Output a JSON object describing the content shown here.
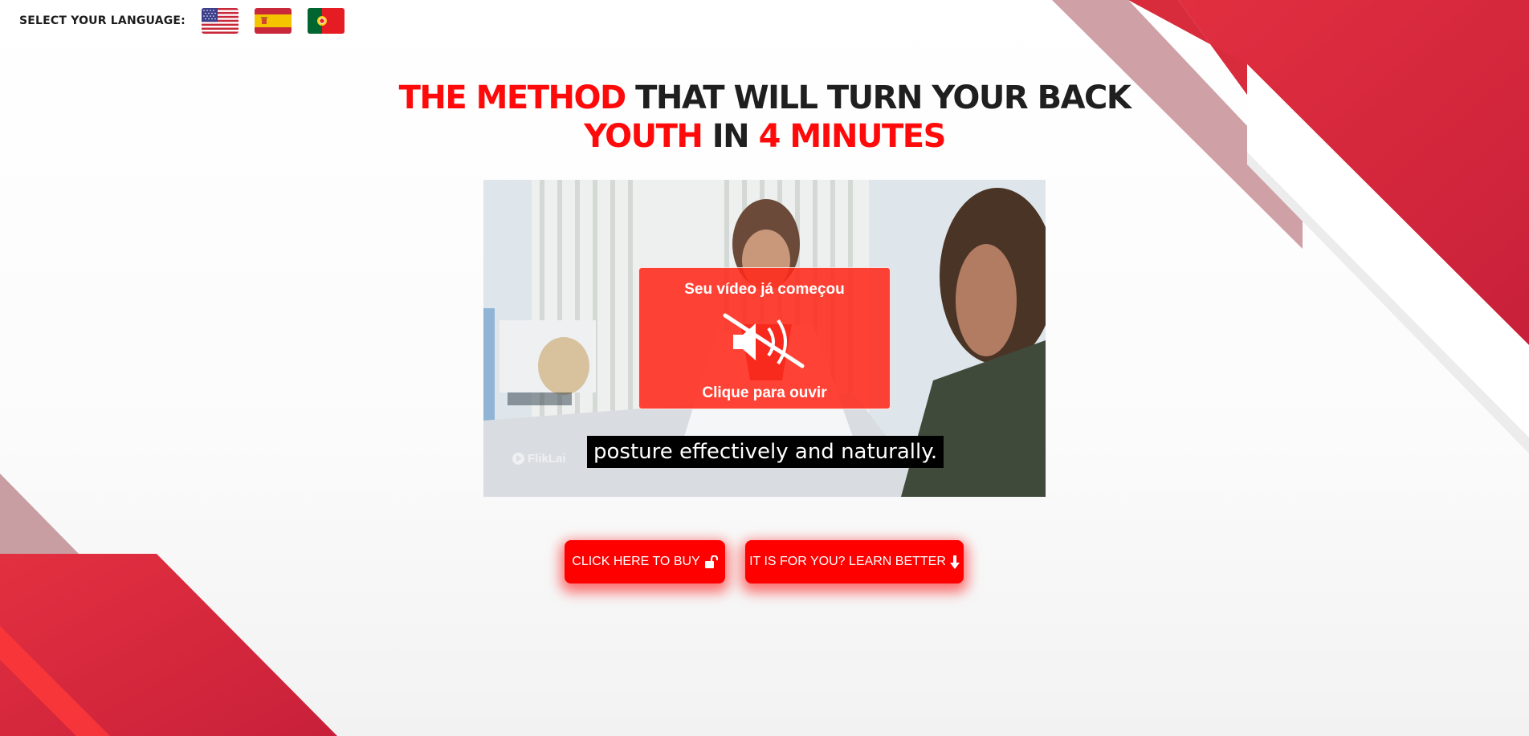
{
  "language_bar": {
    "label": "SELECT YOUR LANGUAGE:",
    "flags": [
      {
        "icon": "us-flag-icon",
        "language": "English"
      },
      {
        "icon": "spain-flag-icon",
        "language": "Español"
      },
      {
        "icon": "portugal-flag-icon",
        "language": "Português"
      }
    ]
  },
  "headline": {
    "line1_red": "THE METHOD",
    "line1_dark": "THAT WILL TURN YOUR BACK",
    "line2_red_a": "YOUTH",
    "line2_dark": "IN",
    "line2_red_b": "4 MINUTES"
  },
  "video": {
    "overlay_top": "Seu vídeo já começou",
    "overlay_icon": "muted-speaker-icon",
    "overlay_bottom": "Clique para ouvir",
    "caption": "posture effectively and naturally.",
    "watermark": "FlikLai"
  },
  "buttons": {
    "buy_label": "CLICK HERE TO BUY",
    "buy_icon": "unlock-icon",
    "learn_label": "IT IS FOR YOU? LEARN BETTER",
    "learn_icon": "arrow-down-icon"
  },
  "colors": {
    "accent_red": "#ff0a0a",
    "button_red": "#ff0000",
    "overlay_red": "#f53a2a",
    "text_dark": "#1f1f1f"
  }
}
